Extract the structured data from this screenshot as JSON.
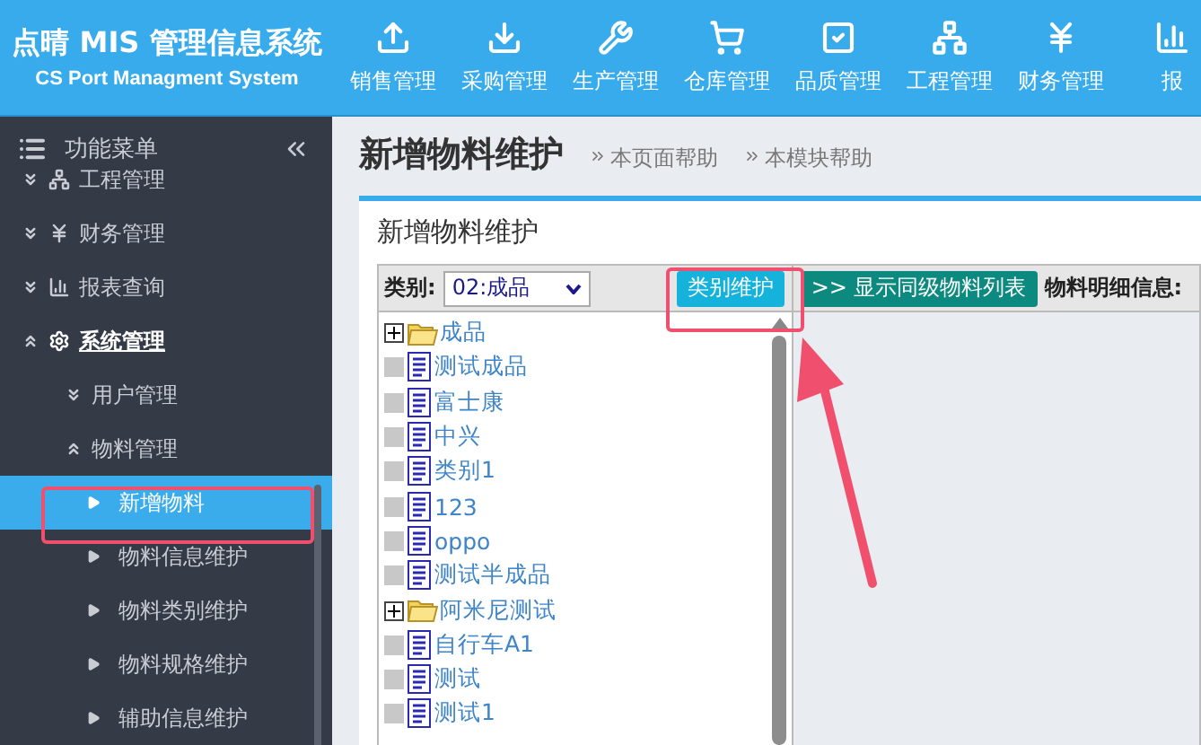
{
  "brand": {
    "title": "点晴 MIS 管理信息系统",
    "subtitle": "CS Port Managment System"
  },
  "nav": [
    {
      "label": "销售管理",
      "kind": "upload"
    },
    {
      "label": "采购管理",
      "kind": "download"
    },
    {
      "label": "生产管理",
      "kind": "wrench"
    },
    {
      "label": "仓库管理",
      "kind": "cart"
    },
    {
      "label": "品质管理",
      "kind": "check"
    },
    {
      "label": "工程管理",
      "kind": "network"
    },
    {
      "label": "财务管理",
      "kind": "yen"
    },
    {
      "label": "报",
      "kind": "chart"
    }
  ],
  "sidebar": {
    "title": "功能菜单",
    "items": [
      {
        "label": "工程管理",
        "kind": "network",
        "expanded": false,
        "active": false
      },
      {
        "label": "财务管理",
        "kind": "yen",
        "expanded": false,
        "active": false
      },
      {
        "label": "报表查询",
        "kind": "chart",
        "expanded": false,
        "active": false
      },
      {
        "label": "系统管理",
        "kind": "gear",
        "expanded": true,
        "active": true,
        "children": [
          {
            "label": "用户管理",
            "expanded": false
          },
          {
            "label": "物料管理",
            "expanded": true,
            "children": [
              {
                "label": "新增物料",
                "selected": true
              },
              {
                "label": "物料信息维护",
                "selected": false
              },
              {
                "label": "物料类别维护",
                "selected": false
              },
              {
                "label": "物料规格维护",
                "selected": false
              },
              {
                "label": "辅助信息维护",
                "selected": false
              }
            ]
          }
        ]
      }
    ]
  },
  "page": {
    "title": "新增物料维护",
    "links": [
      "本页面帮助",
      "本模块帮助"
    ]
  },
  "panel": {
    "title": "新增物料维护",
    "category_label": "类别:",
    "category_value": "02:成品",
    "buttons": [
      {
        "label": "类别维护",
        "kind": "primary"
      },
      {
        "label": ">> 显示同级物料列表",
        "kind": "teal"
      }
    ],
    "detail_label": "物料明细信息:",
    "tree": [
      {
        "label": "成品",
        "kind": "folder",
        "expanded": false
      },
      {
        "label": "测试成品",
        "kind": "doc"
      },
      {
        "label": "富士康",
        "kind": "doc"
      },
      {
        "label": "中兴",
        "kind": "doc"
      },
      {
        "label": "类别1",
        "kind": "doc"
      },
      {
        "label": "123",
        "kind": "doc"
      },
      {
        "label": "oppo",
        "kind": "doc"
      },
      {
        "label": "测试半成品",
        "kind": "doc"
      },
      {
        "label": "阿米尼测试",
        "kind": "folder",
        "expanded": false
      },
      {
        "label": "自行车A1",
        "kind": "doc"
      },
      {
        "label": "测试",
        "kind": "doc"
      },
      {
        "label": "测试1",
        "kind": "doc"
      }
    ]
  }
}
